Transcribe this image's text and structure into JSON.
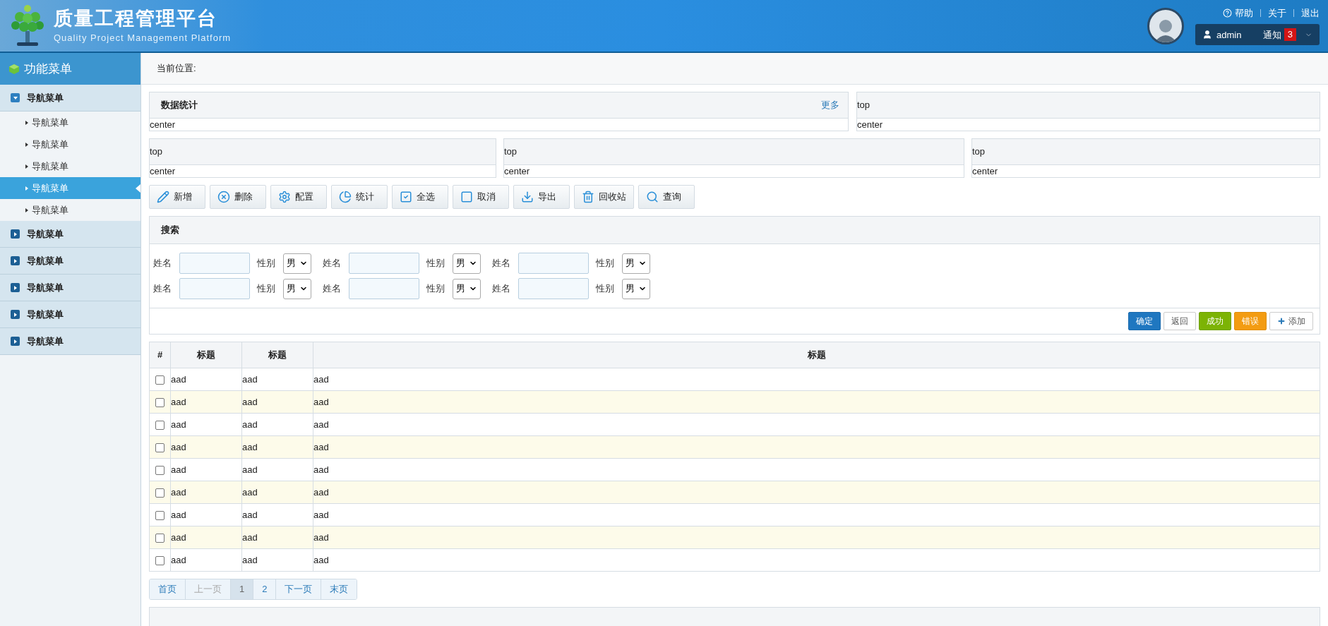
{
  "header": {
    "title": "质量工程管理平台",
    "subtitle": "Quality Project Management Platform",
    "links": [
      "帮助",
      "关于",
      "退出"
    ],
    "user": "admin",
    "notice": "通知",
    "notice_count": "3"
  },
  "sidebar": {
    "title": "功能菜单",
    "groups": [
      {
        "label": "导航菜单",
        "expanded": true,
        "children": [
          {
            "label": "导航菜单",
            "selected": false
          },
          {
            "label": "导航菜单",
            "selected": false
          },
          {
            "label": "导航菜单",
            "selected": false
          },
          {
            "label": "导航菜单",
            "selected": true
          },
          {
            "label": "导航菜单",
            "selected": false
          }
        ]
      },
      {
        "label": "导航菜单",
        "expanded": false
      },
      {
        "label": "导航菜单",
        "expanded": false
      },
      {
        "label": "导航菜单",
        "expanded": false
      },
      {
        "label": "导航菜单",
        "expanded": false
      },
      {
        "label": "导航菜单",
        "expanded": false
      }
    ]
  },
  "breadcrumb": "当前位置:",
  "panels_row1": [
    {
      "title": "数据统计",
      "more": "更多",
      "body": "center"
    },
    {
      "title": "top",
      "body": "center"
    }
  ],
  "panels_row2": [
    {
      "title": "top",
      "body": "center"
    },
    {
      "title": "top",
      "body": "center"
    },
    {
      "title": "top",
      "body": "center"
    }
  ],
  "toolbar": [
    "新增",
    "删除",
    "配置",
    "统计",
    "全选",
    "取消",
    "导出",
    "回收站",
    "查询"
  ],
  "search": {
    "title": "搜索",
    "rows": [
      [
        {
          "label": "姓名",
          "sex_label": "性别",
          "sex": "男"
        },
        {
          "label": "姓名",
          "sex_label": "性别",
          "sex": "男"
        },
        {
          "label": "姓名",
          "sex_label": "性别",
          "sex": "男"
        }
      ],
      [
        {
          "label": "姓名",
          "sex_label": "性别",
          "sex": "男"
        },
        {
          "label": "姓名",
          "sex_label": "性别",
          "sex": "男"
        },
        {
          "label": "姓名",
          "sex_label": "性别",
          "sex": "男"
        }
      ]
    ],
    "buttons": [
      {
        "label": "确定",
        "kind": "primary"
      },
      {
        "label": "返回",
        "kind": "default"
      },
      {
        "label": "成功",
        "kind": "success"
      },
      {
        "label": "错误",
        "kind": "warning"
      },
      {
        "label": "添加",
        "kind": "add"
      }
    ]
  },
  "table": {
    "columns": [
      "#",
      "标题",
      "标题",
      "标题"
    ],
    "rows": [
      {
        "checked": false,
        "cells": [
          "",
          "aad",
          "aad",
          "aad"
        ]
      },
      {
        "checked": false,
        "cells": [
          "",
          "aad",
          "aad",
          "aad"
        ]
      },
      {
        "checked": false,
        "cells": [
          "",
          "aad",
          "aad",
          "aad"
        ]
      },
      {
        "checked": false,
        "cells": [
          "",
          "aad",
          "aad",
          "aad"
        ]
      },
      {
        "checked": false,
        "cells": [
          "",
          "aad",
          "aad",
          "aad"
        ]
      },
      {
        "checked": false,
        "cells": [
          "",
          "aad",
          "aad",
          "aad"
        ]
      },
      {
        "checked": false,
        "cells": [
          "",
          "aad",
          "aad",
          "aad"
        ]
      },
      {
        "checked": false,
        "cells": [
          "",
          "aad",
          "aad",
          "aad"
        ]
      },
      {
        "checked": false,
        "cells": [
          "",
          "aad",
          "aad",
          "aad"
        ]
      }
    ]
  },
  "pagination": [
    {
      "label": "首页",
      "disabled": false,
      "selected": false
    },
    {
      "label": "上一页",
      "disabled": true,
      "selected": false
    },
    {
      "label": "1",
      "disabled": false,
      "selected": true
    },
    {
      "label": "2",
      "disabled": false,
      "selected": false
    },
    {
      "label": "下一页",
      "disabled": false,
      "selected": false
    },
    {
      "label": "末页",
      "disabled": false,
      "selected": false
    }
  ]
}
